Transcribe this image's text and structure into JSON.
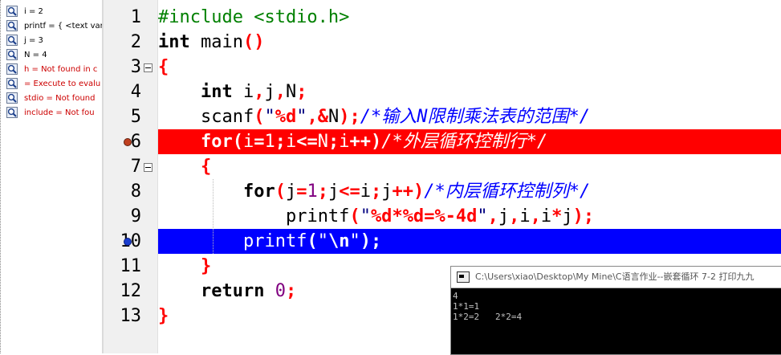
{
  "watch": {
    "items": [
      {
        "text": "i = 2",
        "color": "#000000"
      },
      {
        "text": "printf = { <text vari",
        "color": "#000000"
      },
      {
        "text": "j = 3",
        "color": "#000000"
      },
      {
        "text": "N = 4",
        "color": "#000000"
      },
      {
        "text": "h = Not found in c",
        "color": "#cc0000"
      },
      {
        "text": " = Execute to evalu",
        "color": "#cc0000"
      },
      {
        "text": "stdio = Not found",
        "color": "#cc0000"
      },
      {
        "text": "include = Not fou",
        "color": "#cc0000"
      }
    ]
  },
  "gutter": {
    "lines": [
      "1",
      "2",
      "3",
      "4",
      "5",
      "6",
      "7",
      "8",
      "9",
      "10",
      "11",
      "12",
      "13"
    ]
  },
  "code": {
    "l1_a": "#include <stdio.h>",
    "l2_kw": "int",
    "l2_fn": " main",
    "l2_p": "()",
    "l3": "{",
    "l4_kw": "int",
    "l4_a": " i",
    "l4_c1": ",",
    "l4_b": "j",
    "l4_c2": ",",
    "l4_c": "N",
    "l4_s": ";",
    "l5_fn": "scanf",
    "l5_p1": "(",
    "l5_q1": "\"",
    "l5_fmt": "%d",
    "l5_q2": "\"",
    "l5_c": ",",
    "l5_amp": "&",
    "l5_n": "N",
    "l5_p2": ");",
    "l5_cmt": "/*输入N限制乘法表的范围*/",
    "l6_kw": "for",
    "l6_p1": "(",
    "l6_i": "i",
    "l6_eq": "=",
    "l6_1": "1",
    "l6_s1": ";",
    "l6_i2": "i",
    "l6_le": "<=",
    "l6_n": "N",
    "l6_s2": ";",
    "l6_i3": "i",
    "l6_pp": "++",
    "l6_p2": ")",
    "l6_cmt": "/*外层循环控制行*/",
    "l7": "{",
    "l8_kw": "for",
    "l8_p1": "(",
    "l8_j": "j",
    "l8_eq": "=",
    "l8_1": "1",
    "l8_s1": ";",
    "l8_j2": "j",
    "l8_le": "<=",
    "l8_i": "i",
    "l8_s2": ";",
    "l8_j3": "j",
    "l8_pp": "++",
    "l8_p2": ")",
    "l8_cmt": "/*内层循环控制列*/",
    "l9_fn": "printf",
    "l9_p1": "(",
    "l9_q1": "\"",
    "l9_f1": "%d",
    "l9_s": "*",
    "l9_f2": "%d",
    "l9_e": "=",
    "l9_f3": "%-4d",
    "l9_q2": "\"",
    "l9_c1": ",",
    "l9_j": "j",
    "l9_c2": ",",
    "l9_i": "i",
    "l9_c3": ",",
    "l9_i2": "i",
    "l9_m": "*",
    "l9_j2": "j",
    "l9_p2": ");",
    "l10_fn": "printf",
    "l10_p1": "(",
    "l10_q1": "\"",
    "l10_esc": "\\n",
    "l10_q2": "\"",
    "l10_p2": ");",
    "l11": "}",
    "l12_kw": "return",
    "l12_n": " 0",
    "l12_s": ";",
    "l13": "}"
  },
  "console": {
    "title": "C:\\Users\\xiao\\Desktop\\My Mine\\C语言作业--嵌套循环 7-2 打印九九",
    "output": "4\n1*1=1\n1*2=2   2*2=4"
  },
  "colors": {
    "highlight_red": "#ff0000",
    "highlight_blue": "#0000ff",
    "keyword": "#000000",
    "comment": "#0000ff",
    "operator": "#ff0000",
    "number": "#800080",
    "preprocessor": "#008000"
  },
  "icons": {
    "watch_item": "magnifier-icon",
    "breakpoint": "breakpoint-icon",
    "execution_point": "execution-arrow-icon",
    "console": "console-window-icon"
  }
}
